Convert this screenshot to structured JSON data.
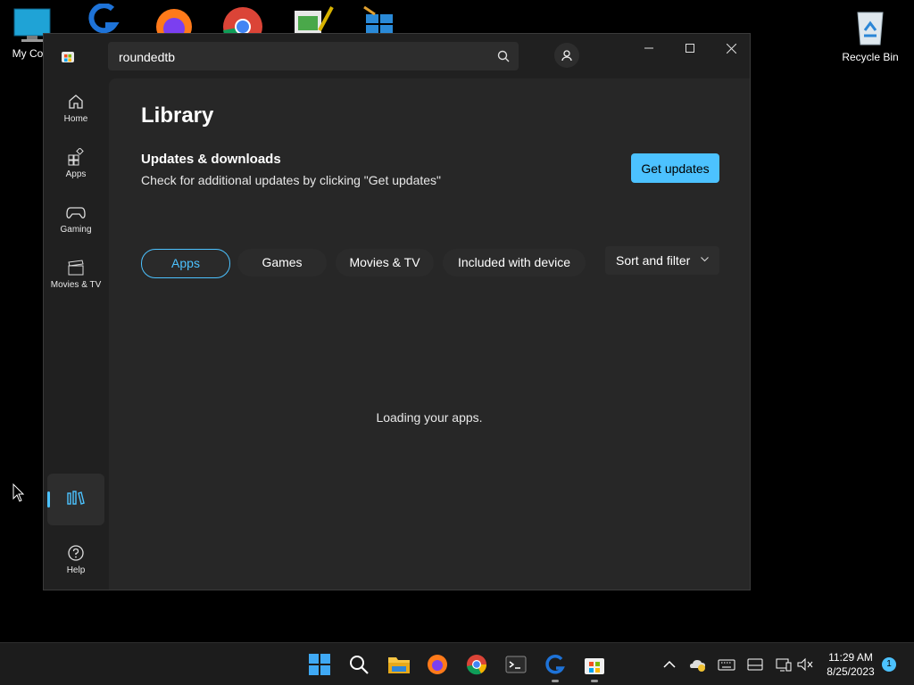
{
  "desktop": {
    "icons": [
      {
        "label": "My Com"
      },
      {
        "label": "Recycle Bin"
      }
    ]
  },
  "window": {
    "search": {
      "value": "roundedtb"
    },
    "nav": {
      "home": "Home",
      "apps": "Apps",
      "gaming": "Gaming",
      "movies": "Movies & TV",
      "help": "Help"
    },
    "page_title": "Library",
    "updates": {
      "title": "Updates & downloads",
      "description": "Check for additional updates by clicking \"Get updates\"",
      "button": "Get updates"
    },
    "tabs": [
      "Apps",
      "Games",
      "Movies & TV",
      "Included with device"
    ],
    "active_tab": "Apps",
    "sort_filter": "Sort and filter",
    "loading_text": "Loading your apps."
  },
  "taskbar": {
    "time": "11:29 AM",
    "date": "8/25/2023",
    "notification_count": "1"
  },
  "colors": {
    "accent": "#4cc2ff",
    "window_bg": "#202020",
    "content_bg": "#272727"
  }
}
